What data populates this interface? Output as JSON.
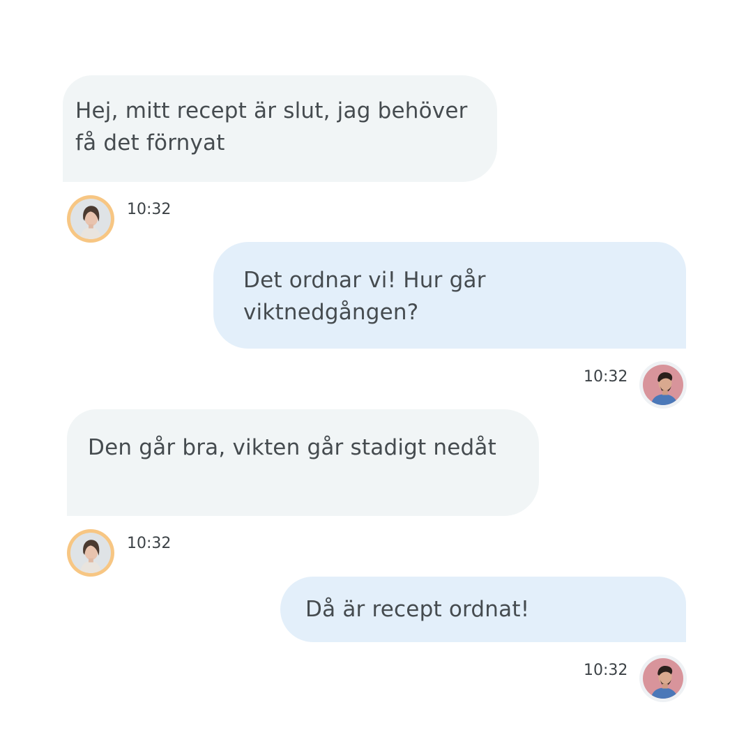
{
  "messages": [
    {
      "text": "Hej, mitt recept är slut, jag behöver få det förnyat",
      "time": "10:32",
      "sender": "patient"
    },
    {
      "text": "Det ordnar vi! Hur går viktnedgången?",
      "time": "10:32",
      "sender": "doctor"
    },
    {
      "text": "Den går bra, vikten går stadigt nedåt",
      "time": "10:32",
      "sender": "patient"
    },
    {
      "text": "Då är recept ordnat!",
      "time": "10:32",
      "sender": "doctor"
    }
  ],
  "colors": {
    "incoming_bubble": "#f1f5f6",
    "outgoing_bubble": "#e3effa",
    "text": "#454b4f",
    "patient_avatar_ring": "#f7c683",
    "doctor_avatar_ring": "#eef1f4"
  },
  "icons": {
    "patient_avatar": "woman-portrait-avatar",
    "doctor_avatar": "man-portrait-avatar"
  }
}
